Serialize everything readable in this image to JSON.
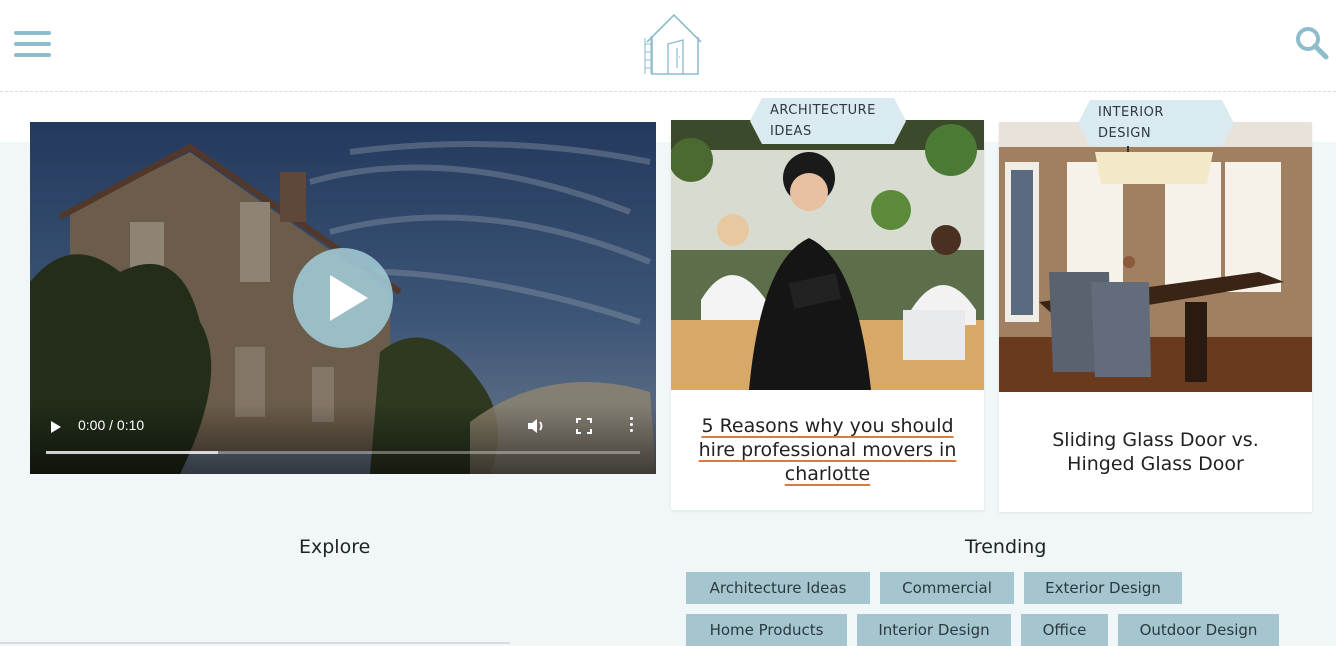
{
  "header": {
    "menu_icon": "hamburger-menu-icon",
    "logo_icon": "house-logo-icon",
    "search_icon": "search-icon"
  },
  "video": {
    "time": "0:00 / 0:10",
    "progress": 0.29,
    "play_icon": "play-icon",
    "volume_icon": "volume-icon",
    "fullscreen_icon": "fullscreen-icon",
    "more_icon": "more-options-icon"
  },
  "cards": [
    {
      "category": "ARCHITECTURE IDEAS",
      "title": "5 Reasons why you should hire professional movers in charlotte"
    },
    {
      "category": "INTERIOR DESIGN",
      "title": "Sliding Glass Door vs. Hinged Glass Door"
    }
  ],
  "explore": {
    "title": "Explore"
  },
  "trending": {
    "title": "Trending",
    "tags": [
      "Architecture Ideas",
      "Commercial",
      "Exterior Design",
      "Home Products",
      "Interior Design",
      "Office",
      "Outdoor Design"
    ]
  },
  "colors": {
    "accent": "#8fbccb",
    "tag_bg": "#a5c6cf",
    "badge_bg": "#daeaf1",
    "link_underline": "#e07a3a",
    "page_bg": "#f1f7f9"
  }
}
